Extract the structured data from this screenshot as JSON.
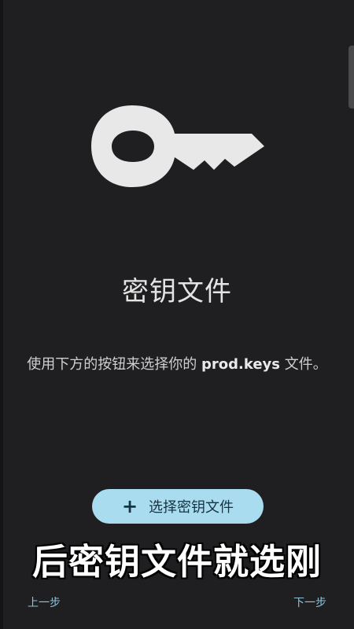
{
  "colors": {
    "background": "#1f1f21",
    "icon": "#e8e8e8",
    "button_background": "#a9dcef",
    "button_text": "#163342",
    "nav_text": "#8fc3d9"
  },
  "page": {
    "icon": "key-icon",
    "title": "密钥文件",
    "description_before": "使用下方的按钮来选择你的 ",
    "description_highlight": "prod.keys",
    "description_after": " 文件。"
  },
  "select_button": {
    "icon": "plus-icon",
    "icon_glyph": "+",
    "label": "选择密钥文件"
  },
  "subtitle": "后密钥文件就选刚",
  "navigation": {
    "prev_label": "上一步",
    "next_label": "下一步"
  }
}
